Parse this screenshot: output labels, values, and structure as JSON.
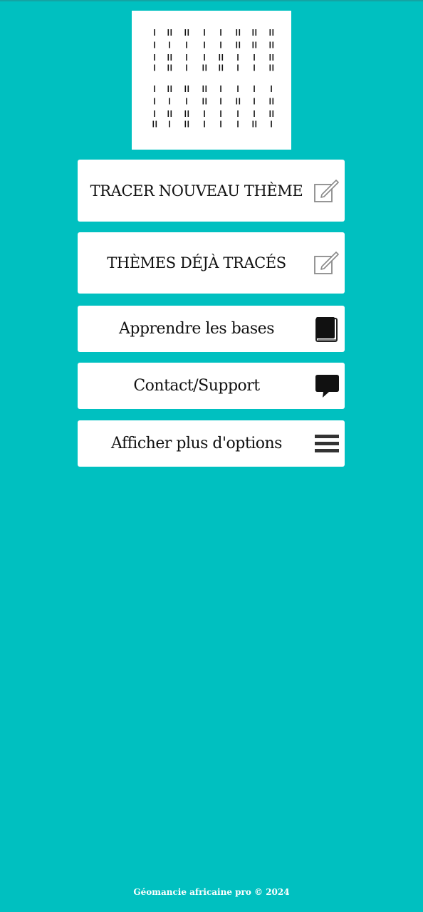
{
  "logo": {
    "icon": "geomancy-figures-logo"
  },
  "menu": {
    "items": [
      {
        "label": "TRACER NOUVEAU THÈME",
        "icon": "edit-icon"
      },
      {
        "label": "THÈMES DÉJÀ TRACÉS",
        "icon": "edit-icon"
      },
      {
        "label": "Apprendre les bases",
        "icon": "book-icon"
      },
      {
        "label": "Contact/Support",
        "icon": "chat-bubble-icon"
      },
      {
        "label": "Afficher plus d'options",
        "icon": "menu-icon"
      }
    ]
  },
  "footer": {
    "text": "Géomancie africaine pro © 2024"
  },
  "colors": {
    "background": "#00c0c0",
    "button": "#ffffff",
    "text": "#111111"
  }
}
